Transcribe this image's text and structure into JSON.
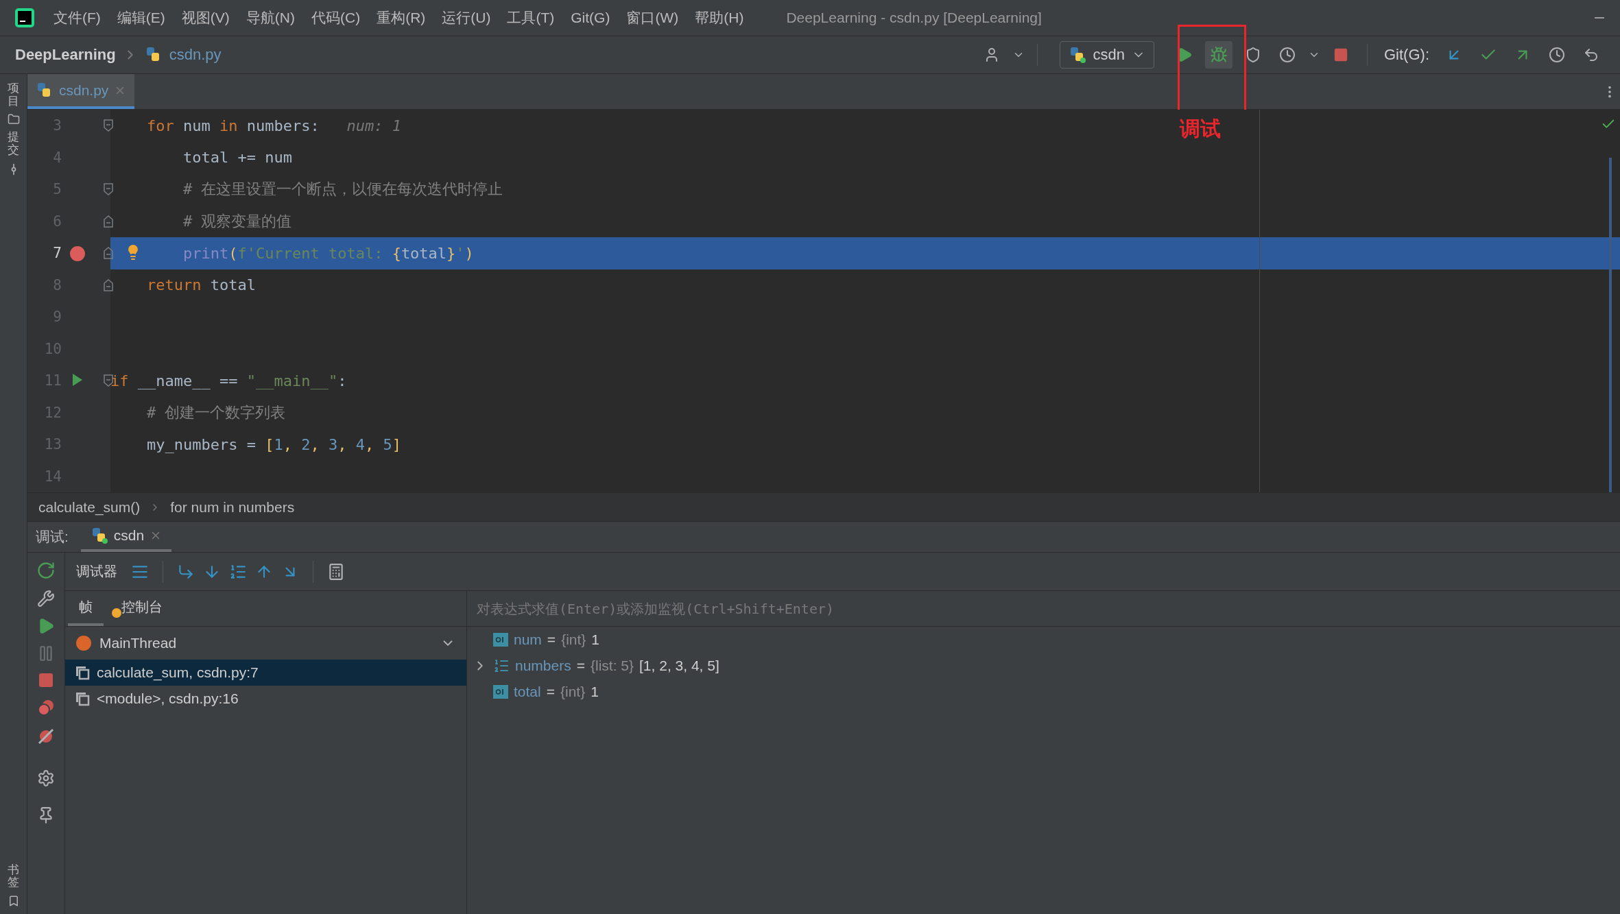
{
  "menu": [
    "文件(F)",
    "编辑(E)",
    "视图(V)",
    "导航(N)",
    "代码(C)",
    "重构(R)",
    "运行(U)",
    "工具(T)",
    "Git(G)",
    "窗口(W)",
    "帮助(H)"
  ],
  "window": {
    "title": "DeepLearning - csdn.py [DeepLearning]"
  },
  "breadcrumb": {
    "project": "DeepLearning",
    "file": "csdn.py"
  },
  "run_config": "csdn",
  "git_label": "Git(G):",
  "annotation": {
    "label": "调试"
  },
  "side_stripe": {
    "top": [
      "项目",
      "提交"
    ],
    "bottom": "书签"
  },
  "editor_tabs": [
    {
      "label": "csdn.py",
      "selected": true
    }
  ],
  "code_lines": [
    {
      "number": "3",
      "fold_start": true,
      "current": false,
      "tokens": [
        {
          "kind": "keyword",
          "text": "    for"
        },
        {
          "kind": "text",
          "text": " num "
        },
        {
          "kind": "keyword",
          "text": "in"
        },
        {
          "kind": "text",
          "text": " numbers:   "
        },
        {
          "kind": "hint",
          "text": "num: 1"
        }
      ]
    },
    {
      "number": "4",
      "current": false,
      "tokens": [
        {
          "kind": "text",
          "text": "        total += num"
        }
      ]
    },
    {
      "number": "5",
      "fold_start": true,
      "current": false,
      "tokens": [
        {
          "kind": "comment",
          "text": "        # 在这里设置一个断点，以便在每次迭代时停止"
        }
      ]
    },
    {
      "number": "6",
      "fold_end": true,
      "current": false,
      "tokens": [
        {
          "kind": "comment",
          "text": "        # 观察变量的值"
        }
      ]
    },
    {
      "number": "7",
      "fold_end": true,
      "current": true,
      "breakpoint": true,
      "bulb": true,
      "tokens": [
        {
          "kind": "builtin",
          "text": "        print"
        },
        {
          "kind": "bracket",
          "text": "("
        },
        {
          "kind": "string",
          "text": "f'Current total: "
        },
        {
          "kind": "bracket",
          "text": "{"
        },
        {
          "kind": "text",
          "text": "total"
        },
        {
          "kind": "bracket",
          "text": "}"
        },
        {
          "kind": "string",
          "text": "'"
        },
        {
          "kind": "bracket",
          "text": ")"
        }
      ]
    },
    {
      "number": "8",
      "fold_end": true,
      "current": false,
      "tokens": [
        {
          "kind": "keyword",
          "text": "    return"
        },
        {
          "kind": "text",
          "text": " total"
        }
      ]
    },
    {
      "number": "9"
    },
    {
      "number": "10"
    },
    {
      "number": "11",
      "fold_start": true,
      "run": true,
      "current": false,
      "tokens": [
        {
          "kind": "keyword",
          "text": "if"
        },
        {
          "kind": "text",
          "text": " __name__ == "
        },
        {
          "kind": "string",
          "text": "\"__main__\""
        },
        {
          "kind": "text",
          "text": ":"
        }
      ]
    },
    {
      "number": "12",
      "current": false,
      "tokens": [
        {
          "kind": "comment",
          "text": "    # 创建一个数字列表"
        }
      ]
    },
    {
      "number": "13",
      "current": false,
      "tokens": [
        {
          "kind": "text",
          "text": "    my_numbers = "
        },
        {
          "kind": "bracket",
          "text": "["
        },
        {
          "kind": "number",
          "text": "1"
        },
        {
          "kind": "bracket",
          "text": ", "
        },
        {
          "kind": "number",
          "text": "2"
        },
        {
          "kind": "bracket",
          "text": ", "
        },
        {
          "kind": "number",
          "text": "3"
        },
        {
          "kind": "bracket",
          "text": ", "
        },
        {
          "kind": "number",
          "text": "4"
        },
        {
          "kind": "bracket",
          "text": ", "
        },
        {
          "kind": "number",
          "text": "5"
        },
        {
          "kind": "bracket",
          "text": "]"
        }
      ]
    },
    {
      "number": "14"
    }
  ],
  "code_path": [
    "calculate_sum()",
    "for num in numbers"
  ],
  "debug": {
    "label": "调试:",
    "tabs": [
      {
        "label": "csdn",
        "selected": true
      }
    ],
    "debugger_label": "调试器",
    "frame_tabs": [
      {
        "label": "帧",
        "selected": true
      },
      {
        "label": "控制台",
        "selected": false
      }
    ],
    "thread": "MainThread",
    "frames": [
      {
        "label": "calculate_sum, csdn.py:7",
        "selected": true
      },
      {
        "label": "<module>, csdn.py:16",
        "selected": false
      }
    ],
    "eval_placeholder": "对表达式求值(Enter)或添加监视(Ctrl+Shift+Enter)",
    "variables": [
      {
        "kind": "scalar",
        "name": "num",
        "separator": "=",
        "type": "{int}",
        "value": "1"
      },
      {
        "kind": "list",
        "name": "numbers",
        "separator": "=",
        "type": "{list: 5}",
        "value": "[1, 2, 3, 4, 5]",
        "expanded": false
      },
      {
        "kind": "scalar",
        "name": "total",
        "separator": "=",
        "type": "{int}",
        "value": "1"
      }
    ]
  }
}
